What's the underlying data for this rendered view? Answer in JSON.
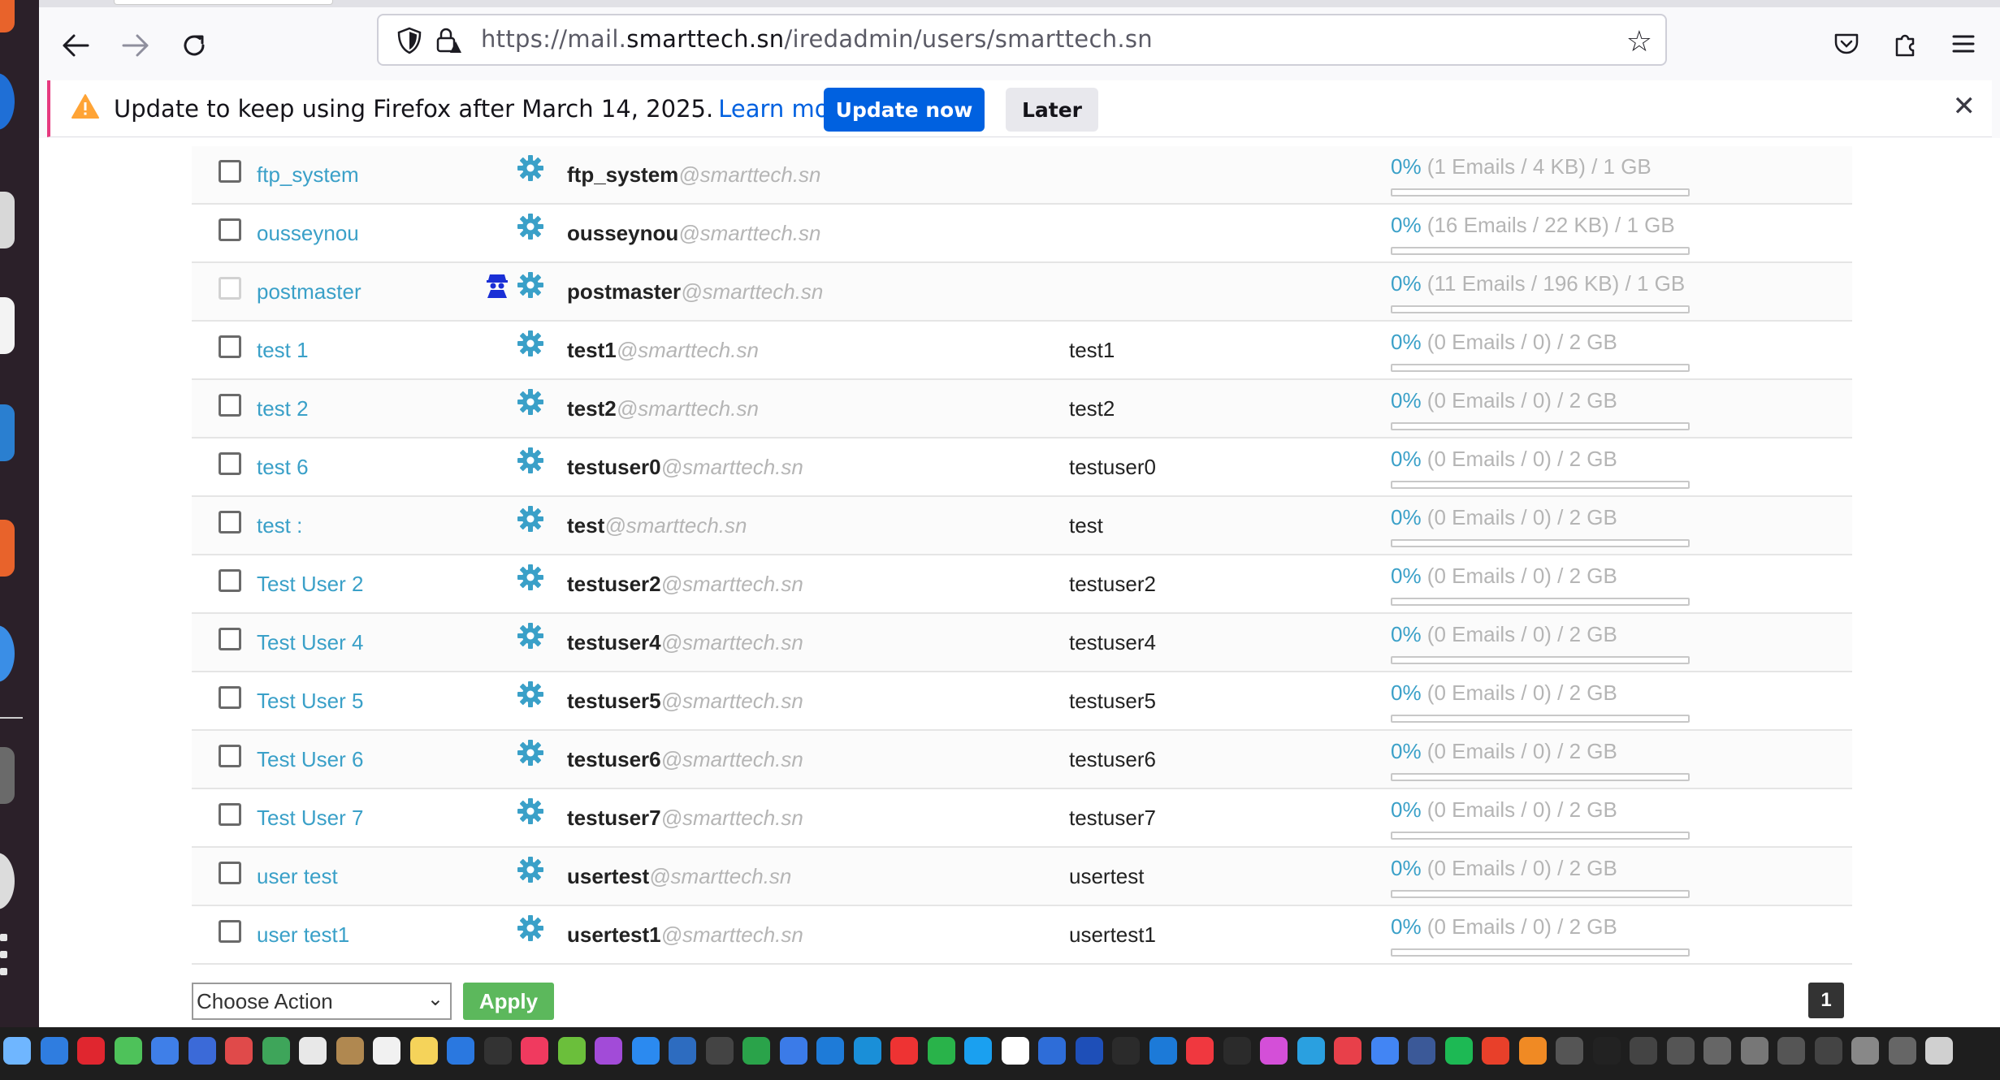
{
  "browser": {
    "url_prefix": "https://mail.",
    "url_host": "smarttech.sn",
    "url_path": "/iredadmin/users/smarttech.sn"
  },
  "notification": {
    "message": "Update to keep using Firefox after March 14, 2025.",
    "link_label": "Learn more",
    "update_label": "Update now",
    "later_label": "Later"
  },
  "colors": {
    "accent": "#3aa0c8",
    "firefox_blue": "#0061e0",
    "apply_green": "#5cb85c"
  },
  "users": [
    {
      "display_name": "ftp_system",
      "local": "ftp_system",
      "domain": "@smarttech.sn",
      "username": "",
      "pct": "0%",
      "quota": " (1 Emails / 4 KB) / 1 GB",
      "usage": 0,
      "admin": false,
      "checkbox_disabled": false
    },
    {
      "display_name": "ousseynou",
      "local": "ousseynou",
      "domain": "@smarttech.sn",
      "username": "",
      "pct": "0%",
      "quota": " (16 Emails / 22 KB) / 1 GB",
      "usage": 0,
      "admin": false,
      "checkbox_disabled": false
    },
    {
      "display_name": "postmaster",
      "local": "postmaster",
      "domain": "@smarttech.sn",
      "username": "",
      "pct": "0%",
      "quota": " (11 Emails / 196 KB) / 1 GB",
      "usage": 0,
      "admin": true,
      "checkbox_disabled": true
    },
    {
      "display_name": "test 1",
      "local": "test1",
      "domain": "@smarttech.sn",
      "username": "test1",
      "pct": "0%",
      "quota": " (0 Emails / 0) / 2 GB",
      "usage": 0,
      "admin": false,
      "checkbox_disabled": false
    },
    {
      "display_name": "test 2",
      "local": "test2",
      "domain": "@smarttech.sn",
      "username": "test2",
      "pct": "0%",
      "quota": " (0 Emails / 0) / 2 GB",
      "usage": 0,
      "admin": false,
      "checkbox_disabled": false
    },
    {
      "display_name": "test 6",
      "local": "testuser0",
      "domain": "@smarttech.sn",
      "username": "testuser0",
      "pct": "0%",
      "quota": " (0 Emails / 0) / 2 GB",
      "usage": 0,
      "admin": false,
      "checkbox_disabled": false
    },
    {
      "display_name": "test :",
      "local": "test",
      "domain": "@smarttech.sn",
      "username": "test",
      "pct": "0%",
      "quota": " (0 Emails / 0) / 2 GB",
      "usage": 0,
      "admin": false,
      "checkbox_disabled": false
    },
    {
      "display_name": "Test User 2",
      "local": "testuser2",
      "domain": "@smarttech.sn",
      "username": "testuser2",
      "pct": "0%",
      "quota": " (0 Emails / 0) / 2 GB",
      "usage": 0,
      "admin": false,
      "checkbox_disabled": false
    },
    {
      "display_name": "Test User 4",
      "local": "testuser4",
      "domain": "@smarttech.sn",
      "username": "testuser4",
      "pct": "0%",
      "quota": " (0 Emails / 0) / 2 GB",
      "usage": 0,
      "admin": false,
      "checkbox_disabled": false
    },
    {
      "display_name": "Test User 5",
      "local": "testuser5",
      "domain": "@smarttech.sn",
      "username": "testuser5",
      "pct": "0%",
      "quota": " (0 Emails / 0) / 2 GB",
      "usage": 0,
      "admin": false,
      "checkbox_disabled": false
    },
    {
      "display_name": "Test User 6",
      "local": "testuser6",
      "domain": "@smarttech.sn",
      "username": "testuser6",
      "pct": "0%",
      "quota": " (0 Emails / 0) / 2 GB",
      "usage": 0,
      "admin": false,
      "checkbox_disabled": false
    },
    {
      "display_name": "Test User 7",
      "local": "testuser7",
      "domain": "@smarttech.sn",
      "username": "testuser7",
      "pct": "0%",
      "quota": " (0 Emails / 0) / 2 GB",
      "usage": 0,
      "admin": false,
      "checkbox_disabled": false
    },
    {
      "display_name": "user test",
      "local": "usertest",
      "domain": "@smarttech.sn",
      "username": "usertest",
      "pct": "0%",
      "quota": " (0 Emails / 0) / 2 GB",
      "usage": 0,
      "admin": false,
      "checkbox_disabled": false
    },
    {
      "display_name": "user test1",
      "local": "usertest1",
      "domain": "@smarttech.sn",
      "username": "usertest1",
      "pct": "0%",
      "quota": " (0 Emails / 0) / 2 GB",
      "usage": 0,
      "admin": false,
      "checkbox_disabled": false
    }
  ],
  "actions": {
    "select_value": "Choose Action",
    "apply_label": "Apply",
    "current_page": "1"
  }
}
